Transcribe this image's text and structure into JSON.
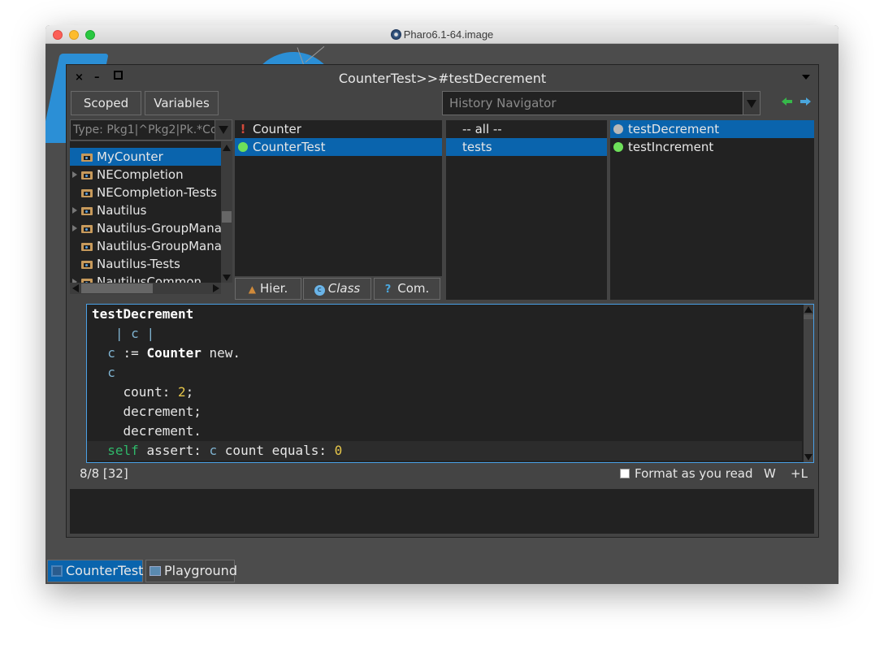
{
  "os_window": {
    "title": "Pharo6.1-64.image",
    "traffic_lights": [
      "close",
      "minimize",
      "maximize"
    ]
  },
  "browser": {
    "title": "CounterTest>>#testDecrement",
    "window_controls": [
      "close-icon",
      "minimize-icon",
      "maximize-icon"
    ],
    "buttons": {
      "scoped": "Scoped",
      "variables": "Variables"
    },
    "history": {
      "placeholder": "History Navigator"
    },
    "package_filter": {
      "placeholder": "Type: Pkg1|^Pkg2|Pk.*Co"
    },
    "packages": [
      {
        "name": "MyCounter",
        "expandable": false,
        "selected": true
      },
      {
        "name": "NECompletion",
        "expandable": true,
        "selected": false
      },
      {
        "name": "NECompletion-Tests",
        "expandable": false,
        "selected": false
      },
      {
        "name": "Nautilus",
        "expandable": true,
        "selected": false
      },
      {
        "name": "Nautilus-GroupMana",
        "expandable": true,
        "selected": false
      },
      {
        "name": "Nautilus-GroupMana",
        "expandable": false,
        "selected": false
      },
      {
        "name": "Nautilus-Tests",
        "expandable": false,
        "selected": false
      },
      {
        "name": "NautilusCommon",
        "expandable": true,
        "selected": false
      }
    ],
    "classes": [
      {
        "name": "Counter",
        "status": "error",
        "selected": false
      },
      {
        "name": "CounterTest",
        "status": "pass",
        "selected": true
      }
    ],
    "class_tabs": {
      "hier": "Hier.",
      "class": "Class",
      "com": "Com."
    },
    "protocols": [
      {
        "name": "-- all --",
        "selected": false
      },
      {
        "name": "tests",
        "selected": true
      }
    ],
    "methods": [
      {
        "name": "testDecrement",
        "status": "untested",
        "selected": true
      },
      {
        "name": "testIncrement",
        "status": "pass",
        "selected": false
      }
    ],
    "code": {
      "method_name": "testDecrement",
      "temps": "| c |",
      "line_assign_var": "c",
      "line_assign_op": ":=",
      "line_assign_class": "Counter",
      "line_assign_msg": "new.",
      "cascade_receiver": "c",
      "cascade_1_sel": "count:",
      "cascade_1_arg": "2",
      "cascade_1_end": ";",
      "cascade_2": "decrement;",
      "cascade_3": "decrement.",
      "assert_self": "self",
      "assert_msg": "assert:",
      "assert_var": "c",
      "assert_rest": "count equals:",
      "assert_arg": "0"
    },
    "status": {
      "position": "8/8 [32]",
      "format_label": "Format as you read",
      "format_checked": false,
      "w": "W",
      "l": "+L"
    }
  },
  "taskbar": [
    {
      "label": "CounterTest",
      "active": true
    },
    {
      "label": "Playground",
      "active": false
    }
  ],
  "colors": {
    "selection": "#0a64ad",
    "pass": "#6ee05a",
    "error": "#d24a3a",
    "untested": "#b8b8b8",
    "self_keyword": "#2fb86a",
    "number": "#e6c64a",
    "variable": "#7fb3d0"
  }
}
